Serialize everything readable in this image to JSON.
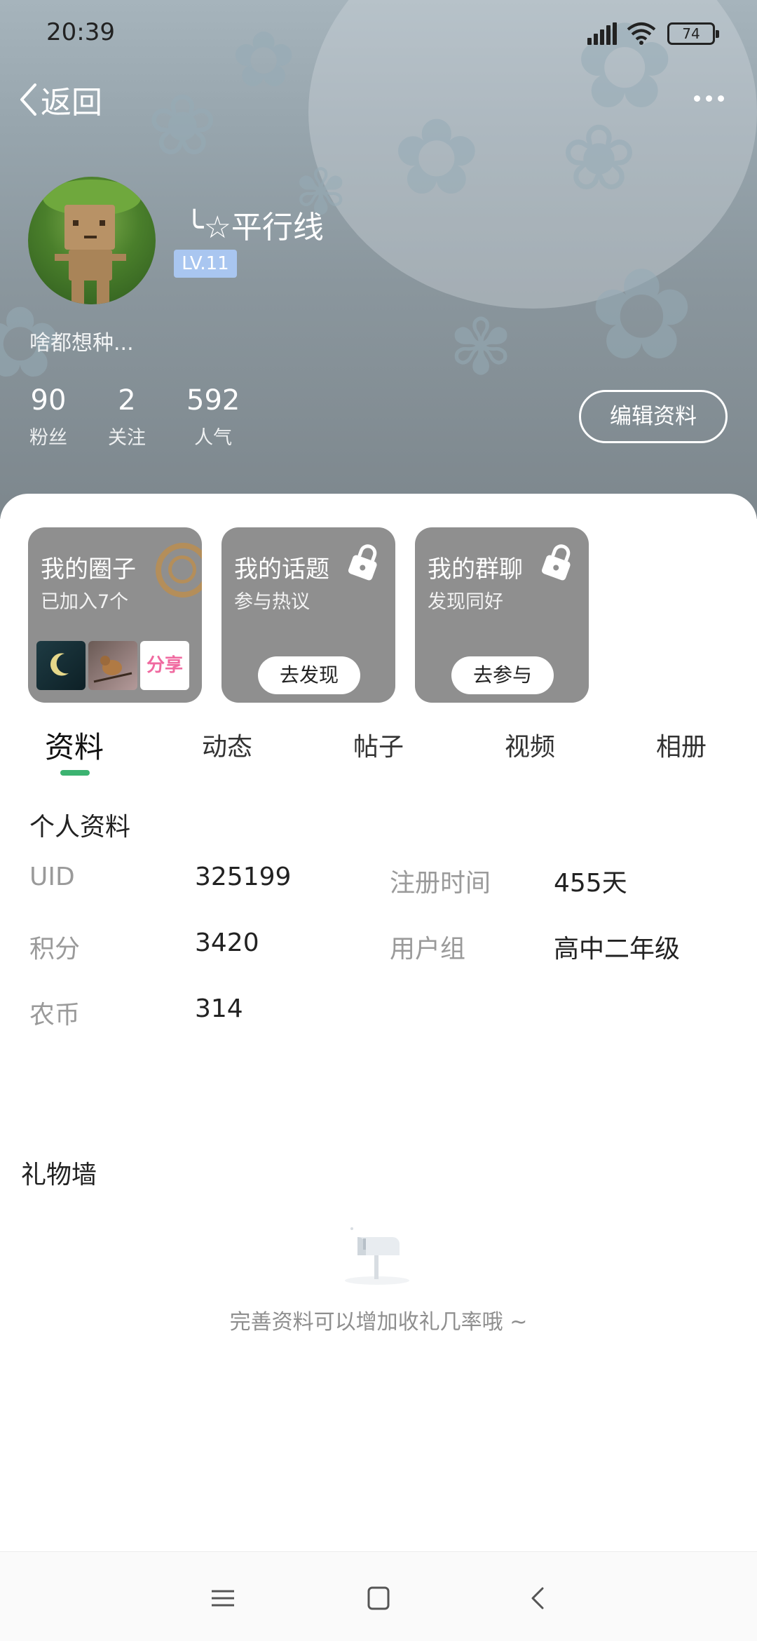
{
  "status_bar": {
    "time": "20:39",
    "battery": "74"
  },
  "nav": {
    "back_label": "返回"
  },
  "profile": {
    "username": "╰☆平行线",
    "level": "LV.11",
    "bio": "啥都想种...",
    "stats": [
      {
        "value": "90",
        "label": "粉丝"
      },
      {
        "value": "2",
        "label": "关注"
      },
      {
        "value": "592",
        "label": "人气"
      }
    ],
    "edit_label": "编辑资料"
  },
  "cards": [
    {
      "title": "我的圈子",
      "subtitle": "已加入7个",
      "thumb_text": "分享"
    },
    {
      "title": "我的话题",
      "subtitle": "参与热议",
      "button": "去发现"
    },
    {
      "title": "我的群聊",
      "subtitle": "发现同好",
      "button": "去参与"
    }
  ],
  "tabs": [
    "资料",
    "动态",
    "帖子",
    "视频",
    "相册"
  ],
  "info": {
    "title": "个人资料",
    "rows": [
      {
        "k1": "UID",
        "v1": "325199",
        "k2": "注册时间",
        "v2": "455天"
      },
      {
        "k1": "积分",
        "v1": "3420",
        "k2": "用户组",
        "v2": "高中二年级"
      },
      {
        "k1": "农币",
        "v1": "314"
      }
    ]
  },
  "gift_wall": {
    "title": "礼物墙",
    "empty_text": "完善资料可以增加收礼几率哦 ~"
  },
  "colors": {
    "accent": "#3cb371",
    "level_badge": "#a9c6f0",
    "card_bg": "#8f8f8f"
  }
}
